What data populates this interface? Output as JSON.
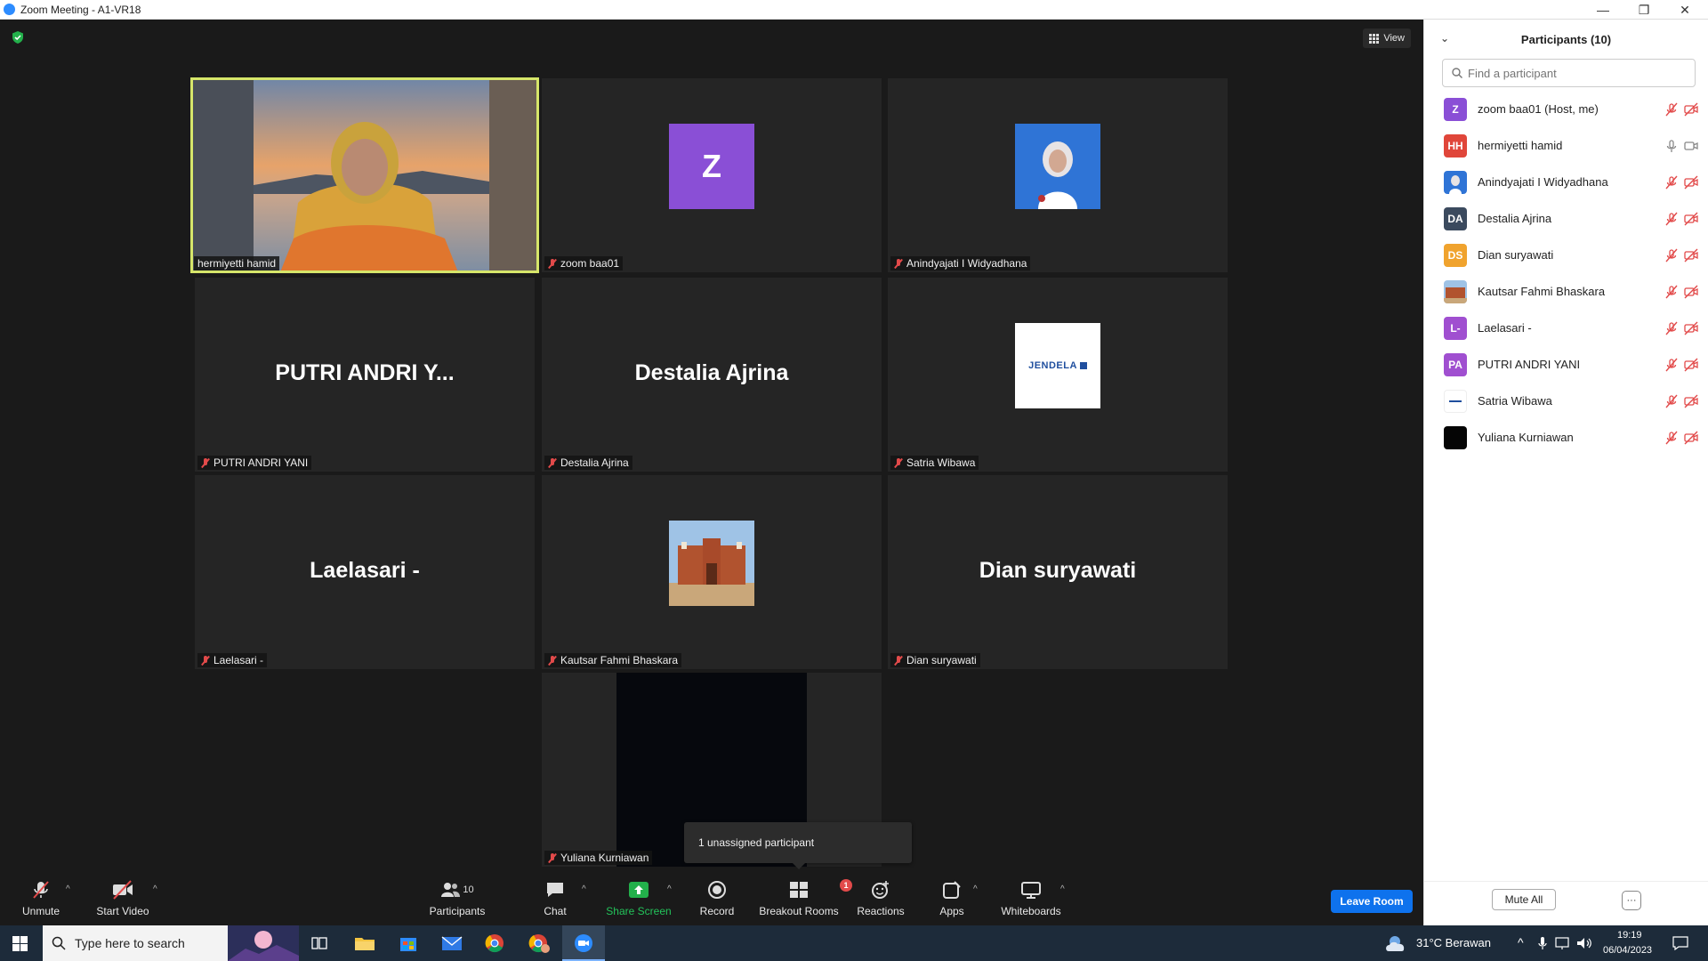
{
  "window": {
    "title": "Zoom Meeting - A1-VR18",
    "minimize": "—",
    "restore": "❐",
    "close": "✕"
  },
  "meeting": {
    "view_label": "View",
    "tiles": [
      {
        "name": "hermiyetti hamid",
        "muted": false,
        "type": "video",
        "active": true
      },
      {
        "name": "zoom baa01",
        "muted": true,
        "type": "letter",
        "letter": "Z",
        "color": "#8a4fd6"
      },
      {
        "name": "Anindyajati I Widyadhana",
        "muted": true,
        "type": "photo"
      },
      {
        "name": "PUTRI ANDRI YANI",
        "display": "PUTRI ANDRI Y...",
        "muted": true,
        "type": "text"
      },
      {
        "name": "Destalia Ajrina",
        "display": "Destalia Ajrina",
        "muted": true,
        "type": "text"
      },
      {
        "name": "Satria Wibawa",
        "muted": true,
        "type": "logo",
        "logo_text": "JENDELA"
      },
      {
        "name": "Laelasari -",
        "display": "Laelasari -",
        "muted": true,
        "type": "text"
      },
      {
        "name": "Kautsar Fahmi Bhaskara",
        "muted": true,
        "type": "photo"
      },
      {
        "name": "Dian suryawati",
        "display": "Dian suryawati",
        "muted": true,
        "type": "text"
      },
      {
        "name": "Yuliana Kurniawan",
        "muted": true,
        "type": "dark"
      }
    ],
    "unassigned_popup": "1 unassigned participant"
  },
  "toolbar": {
    "unmute": "Unmute",
    "start_video": "Start Video",
    "participants": "Participants",
    "participants_count": "10",
    "chat": "Chat",
    "share_screen": "Share Screen",
    "record": "Record",
    "breakout_rooms": "Breakout Rooms",
    "breakout_badge": "1",
    "reactions": "Reactions",
    "apps": "Apps",
    "whiteboards": "Whiteboards",
    "leave_room": "Leave Room"
  },
  "panel": {
    "title": "Participants (10)",
    "search_placeholder": "Find a participant",
    "participants": [
      {
        "name": "zoom baa01 (Host, me)",
        "initials": "Z",
        "color": "#8a4fd6",
        "muted": true
      },
      {
        "name": "hermiyetti hamid",
        "initials": "HH",
        "color": "#e0463a",
        "muted": false
      },
      {
        "name": "Anindyajati I Widyadhana",
        "initials": "",
        "color": "#dfe8f3",
        "muted": true
      },
      {
        "name": "Destalia Ajrina",
        "initials": "DA",
        "color": "#3b4a5e",
        "muted": true
      },
      {
        "name": "Dian suryawati",
        "initials": "DS",
        "color": "#f0a32e",
        "muted": true
      },
      {
        "name": "Kautsar Fahmi Bhaskara",
        "initials": "",
        "color": "#b5744a",
        "muted": true
      },
      {
        "name": "Laelasari -",
        "initials": "L-",
        "color": "#a04fd0",
        "muted": true
      },
      {
        "name": "PUTRI ANDRI YANI",
        "initials": "PA",
        "color": "#a04fd0",
        "muted": true
      },
      {
        "name": "Satria Wibawa",
        "initials": "",
        "color": "#ffffff",
        "muted": true
      },
      {
        "name": "Yuliana Kurniawan",
        "initials": "",
        "color": "#050505",
        "muted": true
      }
    ],
    "mute_all": "Mute All",
    "more": "···"
  },
  "taskbar": {
    "search_placeholder": "Type here to search",
    "weather": "31°C Berawan",
    "time": "19:19",
    "date": "06/04/2023"
  }
}
